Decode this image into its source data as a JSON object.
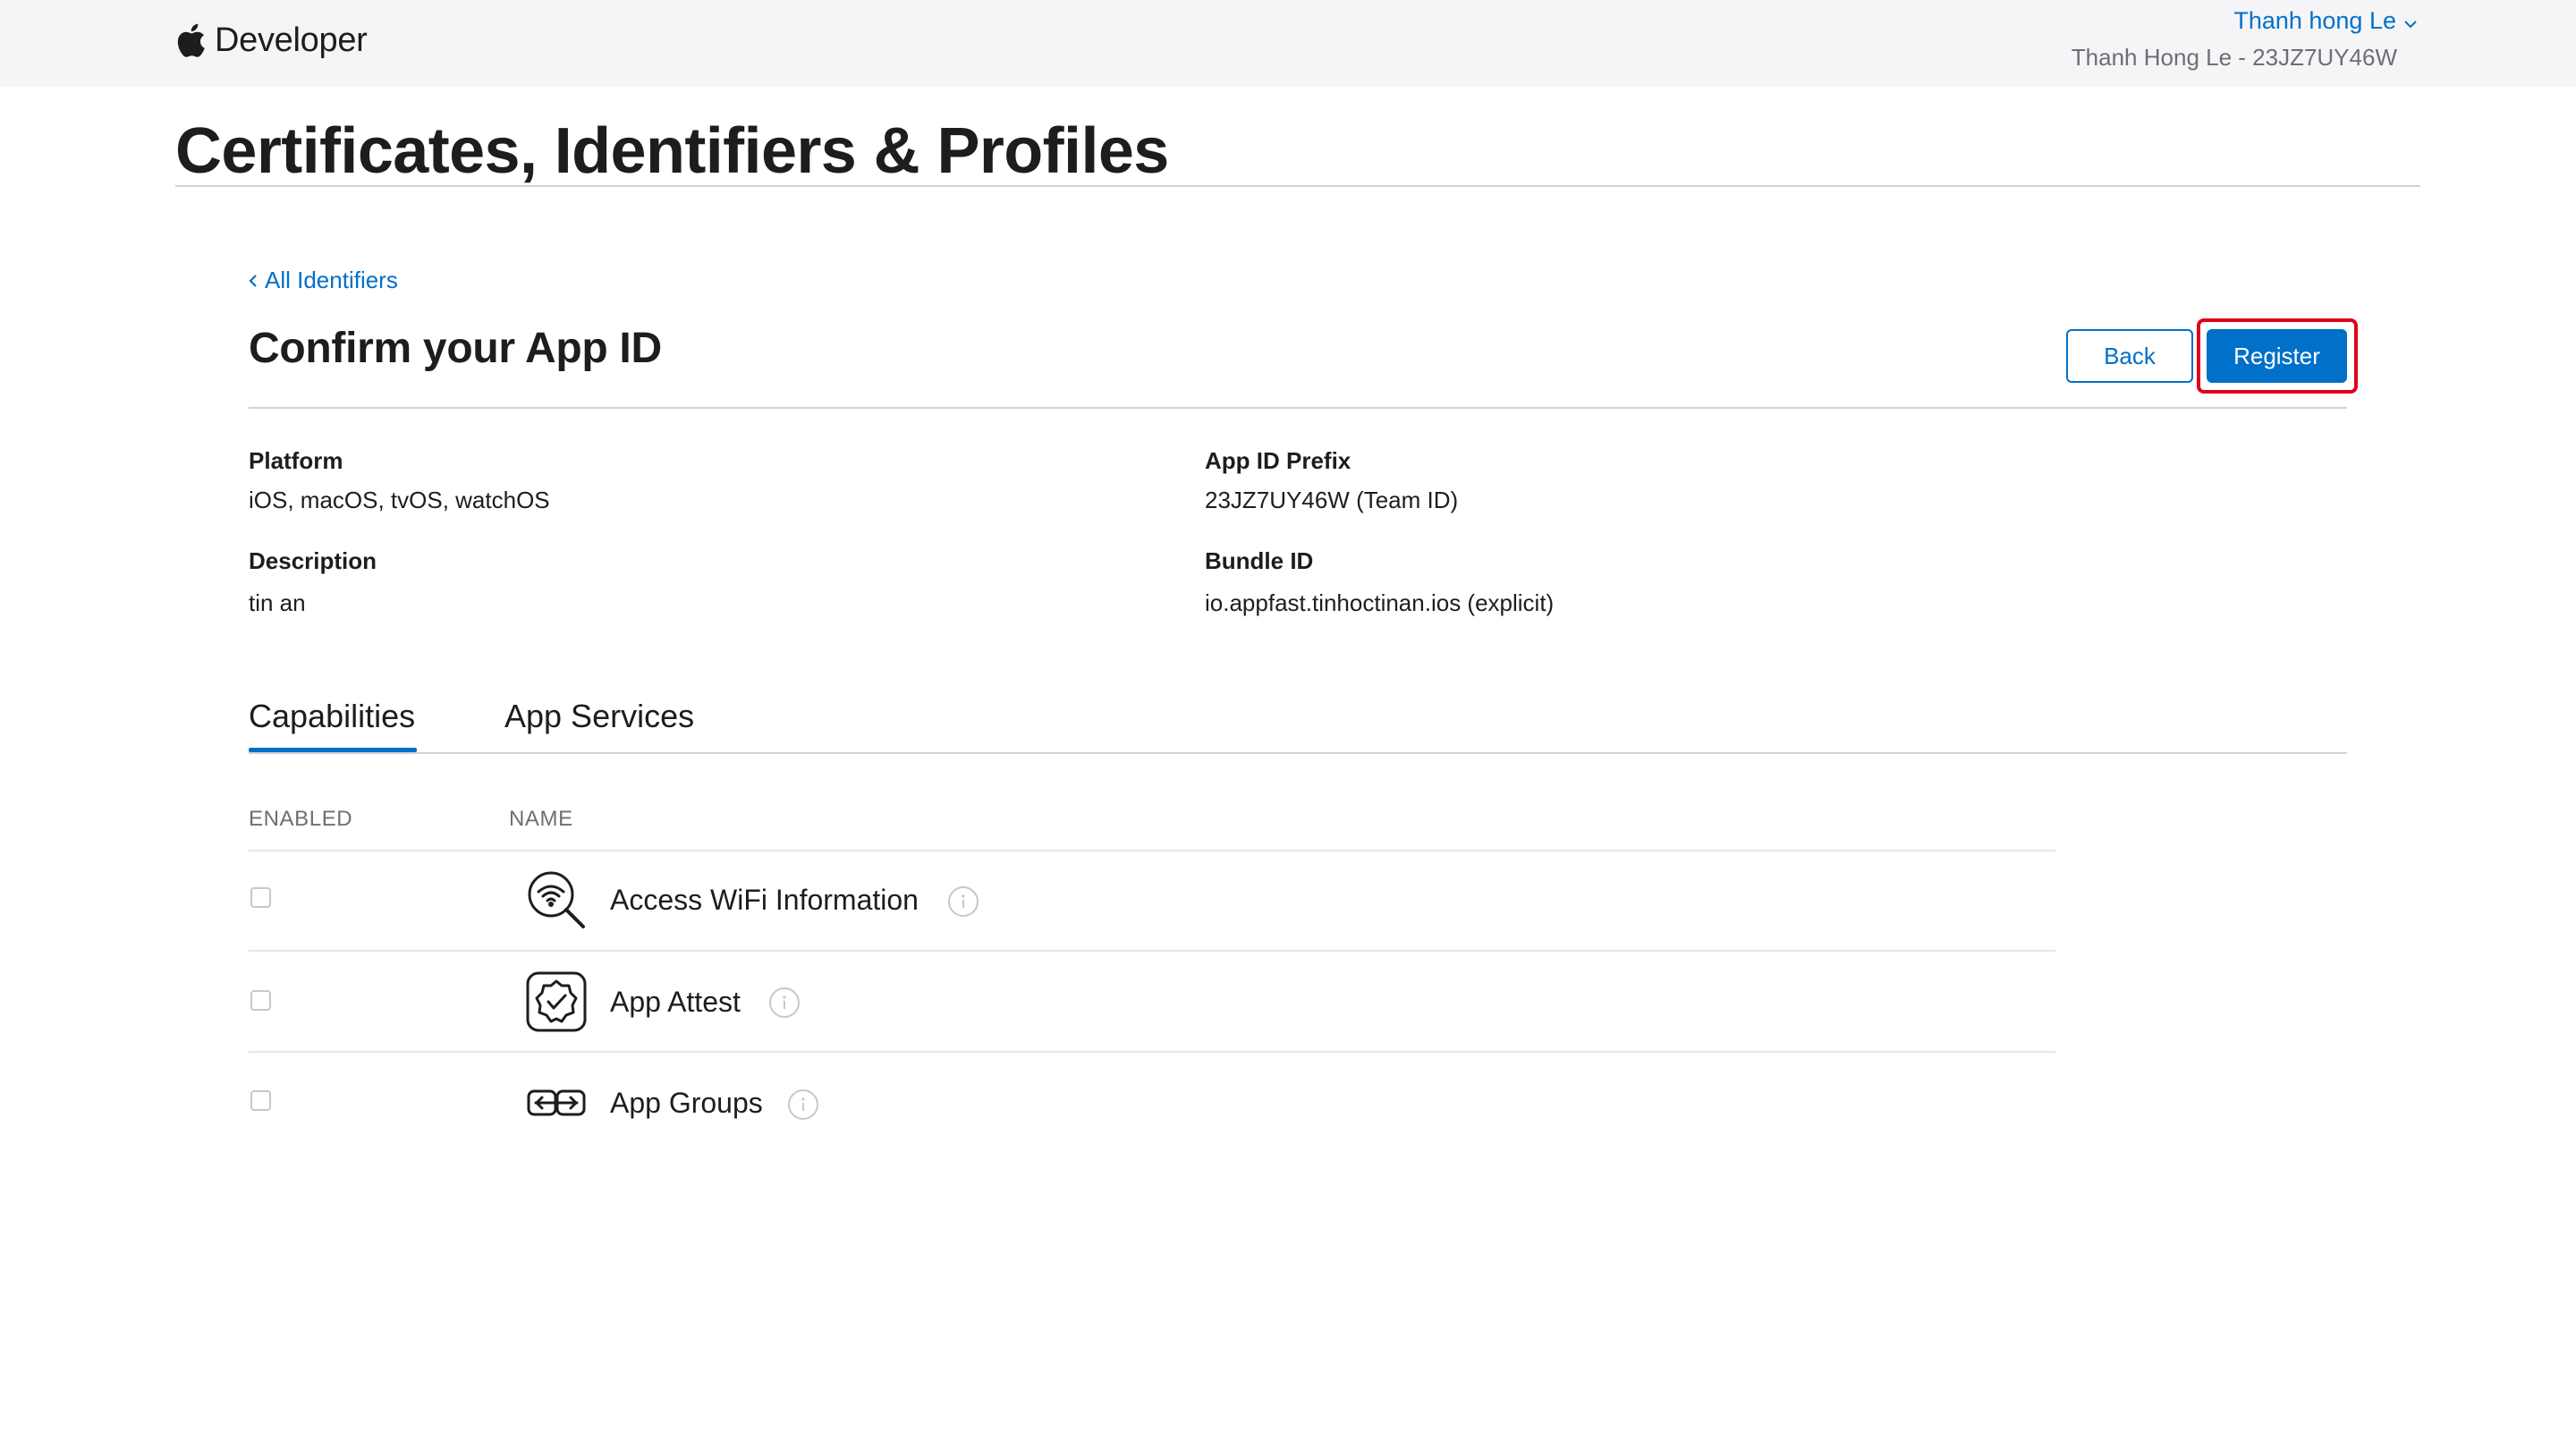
{
  "header": {
    "brand": "Developer",
    "account_name": "Thanh hong Le",
    "team_label": "Thanh Hong Le - 23JZ7UY46W"
  },
  "page_title": "Certificates, Identifiers & Profiles",
  "breadcrumb": {
    "back_label": "All Identifiers"
  },
  "section": {
    "title": "Confirm your App ID",
    "back_button": "Back",
    "register_button": "Register"
  },
  "details": {
    "platform_label": "Platform",
    "platform_value": "iOS, macOS, tvOS, watchOS",
    "description_label": "Description",
    "description_value": "tin an",
    "prefix_label": "App ID Prefix",
    "prefix_value": "23JZ7UY46W (Team ID)",
    "bundle_label": "Bundle ID",
    "bundle_value": "io.appfast.tinhoctinan.ios (explicit)"
  },
  "tabs": [
    {
      "label": "Capabilities",
      "active": true
    },
    {
      "label": "App Services",
      "active": false
    }
  ],
  "table": {
    "col_enabled": "ENABLED",
    "col_name": "NAME",
    "rows": [
      {
        "name": "Access WiFi Information",
        "enabled": false,
        "icon": "wifi-search-icon"
      },
      {
        "name": "App Attest",
        "enabled": false,
        "icon": "badge-check-icon"
      },
      {
        "name": "App Groups",
        "enabled": false,
        "icon": "app-groups-icon"
      }
    ]
  },
  "colors": {
    "accent": "#0070c9",
    "highlight": "#e0001b"
  }
}
